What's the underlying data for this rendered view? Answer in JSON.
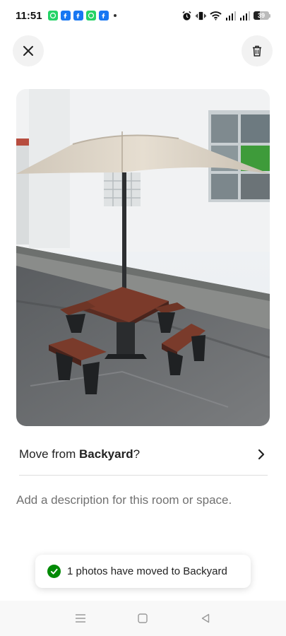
{
  "status_bar": {
    "time": "11:51",
    "battery_level": "39",
    "notification_icons": [
      "whatsapp-icon",
      "facebook-icon",
      "facebook-icon",
      "whatsapp-icon",
      "facebook-icon"
    ],
    "system_icons": [
      "alarm-icon",
      "vibrate-icon",
      "wifi-icon",
      "signal-icon",
      "signal-icon",
      "battery-icon"
    ]
  },
  "header": {
    "close_icon": "close-icon",
    "delete_icon": "trash-icon"
  },
  "photo": {
    "subject": "patio table with umbrella and benches"
  },
  "move": {
    "prefix": "Move from ",
    "room": "Backyard",
    "suffix": "?",
    "icon": "chevron-right-icon"
  },
  "description": {
    "placeholder": "Add a description for this room or space.",
    "value": ""
  },
  "toast": {
    "icon": "check-circle-icon",
    "message": "1 photos have moved to Backyard",
    "color": "#008a05"
  },
  "nav_bar": {
    "icons": [
      "menu-icon",
      "home-square-icon",
      "back-triangle-icon"
    ]
  }
}
